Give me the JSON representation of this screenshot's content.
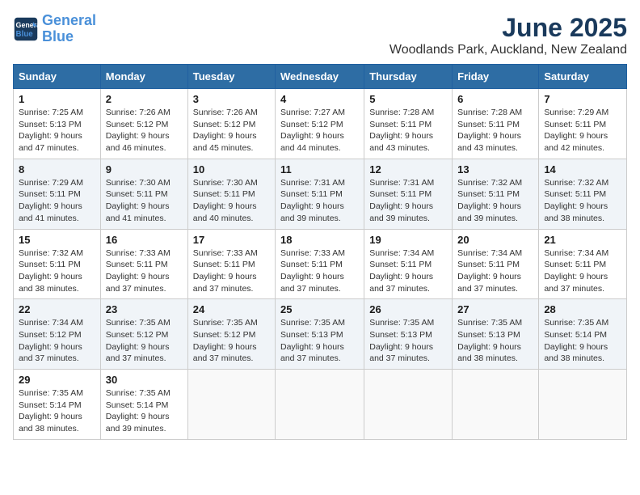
{
  "logo": {
    "line1": "General",
    "line2": "Blue"
  },
  "title": "June 2025",
  "subtitle": "Woodlands Park, Auckland, New Zealand",
  "weekdays": [
    "Sunday",
    "Monday",
    "Tuesday",
    "Wednesday",
    "Thursday",
    "Friday",
    "Saturday"
  ],
  "days": [
    {
      "date": "1",
      "sunrise": "7:25 AM",
      "sunset": "5:13 PM",
      "daylight": "9 hours and 47 minutes."
    },
    {
      "date": "2",
      "sunrise": "7:26 AM",
      "sunset": "5:12 PM",
      "daylight": "9 hours and 46 minutes."
    },
    {
      "date": "3",
      "sunrise": "7:26 AM",
      "sunset": "5:12 PM",
      "daylight": "9 hours and 45 minutes."
    },
    {
      "date": "4",
      "sunrise": "7:27 AM",
      "sunset": "5:12 PM",
      "daylight": "9 hours and 44 minutes."
    },
    {
      "date": "5",
      "sunrise": "7:28 AM",
      "sunset": "5:11 PM",
      "daylight": "9 hours and 43 minutes."
    },
    {
      "date": "6",
      "sunrise": "7:28 AM",
      "sunset": "5:11 PM",
      "daylight": "9 hours and 43 minutes."
    },
    {
      "date": "7",
      "sunrise": "7:29 AM",
      "sunset": "5:11 PM",
      "daylight": "9 hours and 42 minutes."
    },
    {
      "date": "8",
      "sunrise": "7:29 AM",
      "sunset": "5:11 PM",
      "daylight": "9 hours and 41 minutes."
    },
    {
      "date": "9",
      "sunrise": "7:30 AM",
      "sunset": "5:11 PM",
      "daylight": "9 hours and 41 minutes."
    },
    {
      "date": "10",
      "sunrise": "7:30 AM",
      "sunset": "5:11 PM",
      "daylight": "9 hours and 40 minutes."
    },
    {
      "date": "11",
      "sunrise": "7:31 AM",
      "sunset": "5:11 PM",
      "daylight": "9 hours and 39 minutes."
    },
    {
      "date": "12",
      "sunrise": "7:31 AM",
      "sunset": "5:11 PM",
      "daylight": "9 hours and 39 minutes."
    },
    {
      "date": "13",
      "sunrise": "7:32 AM",
      "sunset": "5:11 PM",
      "daylight": "9 hours and 39 minutes."
    },
    {
      "date": "14",
      "sunrise": "7:32 AM",
      "sunset": "5:11 PM",
      "daylight": "9 hours and 38 minutes."
    },
    {
      "date": "15",
      "sunrise": "7:32 AM",
      "sunset": "5:11 PM",
      "daylight": "9 hours and 38 minutes."
    },
    {
      "date": "16",
      "sunrise": "7:33 AM",
      "sunset": "5:11 PM",
      "daylight": "9 hours and 37 minutes."
    },
    {
      "date": "17",
      "sunrise": "7:33 AM",
      "sunset": "5:11 PM",
      "daylight": "9 hours and 37 minutes."
    },
    {
      "date": "18",
      "sunrise": "7:33 AM",
      "sunset": "5:11 PM",
      "daylight": "9 hours and 37 minutes."
    },
    {
      "date": "19",
      "sunrise": "7:34 AM",
      "sunset": "5:11 PM",
      "daylight": "9 hours and 37 minutes."
    },
    {
      "date": "20",
      "sunrise": "7:34 AM",
      "sunset": "5:11 PM",
      "daylight": "9 hours and 37 minutes."
    },
    {
      "date": "21",
      "sunrise": "7:34 AM",
      "sunset": "5:11 PM",
      "daylight": "9 hours and 37 minutes."
    },
    {
      "date": "22",
      "sunrise": "7:34 AM",
      "sunset": "5:12 PM",
      "daylight": "9 hours and 37 minutes."
    },
    {
      "date": "23",
      "sunrise": "7:35 AM",
      "sunset": "5:12 PM",
      "daylight": "9 hours and 37 minutes."
    },
    {
      "date": "24",
      "sunrise": "7:35 AM",
      "sunset": "5:12 PM",
      "daylight": "9 hours and 37 minutes."
    },
    {
      "date": "25",
      "sunrise": "7:35 AM",
      "sunset": "5:13 PM",
      "daylight": "9 hours and 37 minutes."
    },
    {
      "date": "26",
      "sunrise": "7:35 AM",
      "sunset": "5:13 PM",
      "daylight": "9 hours and 37 minutes."
    },
    {
      "date": "27",
      "sunrise": "7:35 AM",
      "sunset": "5:13 PM",
      "daylight": "9 hours and 38 minutes."
    },
    {
      "date": "28",
      "sunrise": "7:35 AM",
      "sunset": "5:14 PM",
      "daylight": "9 hours and 38 minutes."
    },
    {
      "date": "29",
      "sunrise": "7:35 AM",
      "sunset": "5:14 PM",
      "daylight": "9 hours and 38 minutes."
    },
    {
      "date": "30",
      "sunrise": "7:35 AM",
      "sunset": "5:14 PM",
      "daylight": "9 hours and 39 minutes."
    }
  ],
  "labels": {
    "sunrise": "Sunrise:",
    "sunset": "Sunset:",
    "daylight": "Daylight:"
  }
}
